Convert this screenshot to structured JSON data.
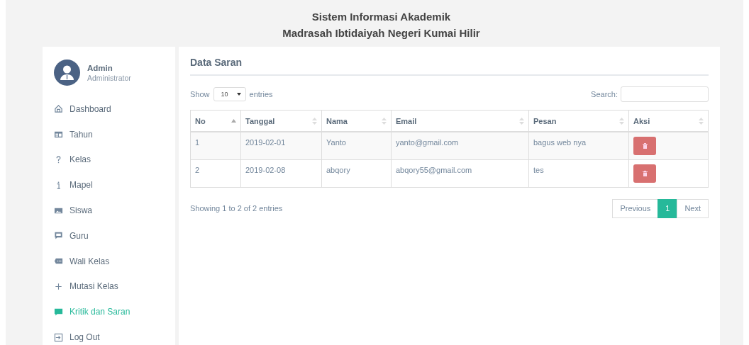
{
  "header": {
    "title_lines": [
      "Sistem Informasi Akademik",
      "Madrasah Ibtidaiyah Negeri Kumai Hilir"
    ]
  },
  "user": {
    "name": "Admin",
    "role": "Administrator"
  },
  "sidebar": {
    "items": [
      {
        "label": "Dashboard",
        "selected": false
      },
      {
        "label": "Tahun",
        "selected": false
      },
      {
        "label": "Kelas",
        "selected": false
      },
      {
        "label": "Mapel",
        "selected": false
      },
      {
        "label": "Siswa",
        "selected": false
      },
      {
        "label": "Guru",
        "selected": false
      },
      {
        "label": "Wali Kelas",
        "selected": false
      },
      {
        "label": "Mutasi Kelas",
        "selected": false
      },
      {
        "label": "Kritik dan Saran",
        "selected": true
      },
      {
        "label": "Log Out",
        "selected": false
      }
    ]
  },
  "panel": {
    "title": "Data Saran",
    "length": {
      "before": "Show",
      "value": "10",
      "after": "entries"
    },
    "search": {
      "label": "Search:"
    },
    "table": {
      "columns": [
        {
          "label": "No",
          "sorted": true
        },
        {
          "label": "Tanggal",
          "sorted": false
        },
        {
          "label": "Nama",
          "sorted": false
        },
        {
          "label": "Email",
          "sorted": false
        },
        {
          "label": "Pesan",
          "sorted": false
        },
        {
          "label": "Aksi",
          "sorted": false
        }
      ],
      "rows": [
        {
          "cells": [
            "1",
            "2019-02-01",
            "Yanto",
            "yanto@gmail.com",
            "bagus web nya"
          ]
        },
        {
          "cells": [
            "2",
            "2019-02-08",
            "abqory",
            "abqory55@gmail.com",
            "tes"
          ]
        }
      ]
    },
    "info": "Showing 1 to 2 of 2 entries",
    "pagination": [
      {
        "label": "Previous",
        "selected": false
      },
      {
        "label": "1",
        "selected": true
      },
      {
        "label": "Next",
        "selected": false
      }
    ]
  }
}
